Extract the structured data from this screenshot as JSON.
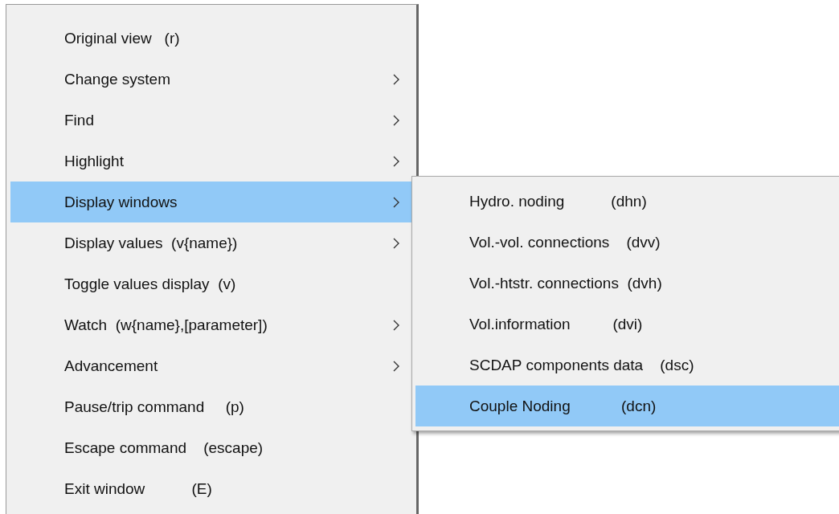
{
  "menu": {
    "items": [
      {
        "label": "Original view   (r)",
        "submenu": false,
        "selected": false
      },
      {
        "label": "Change system",
        "submenu": true,
        "selected": false
      },
      {
        "label": "Find",
        "submenu": true,
        "selected": false
      },
      {
        "label": "Highlight",
        "submenu": true,
        "selected": false
      },
      {
        "label": "Display windows",
        "submenu": true,
        "selected": true
      },
      {
        "label": "Display values  (v{name})",
        "submenu": true,
        "selected": false
      },
      {
        "label": "Toggle values display  (v)",
        "submenu": false,
        "selected": false
      },
      {
        "label": "Watch  (w{name},[parameter])",
        "submenu": true,
        "selected": false
      },
      {
        "label": "Advancement",
        "submenu": true,
        "selected": false
      },
      {
        "label": "Pause/trip command     (p)",
        "submenu": false,
        "selected": false
      },
      {
        "label": "Escape command    (escape)",
        "submenu": false,
        "selected": false
      },
      {
        "label": "Exit window           (E)",
        "submenu": false,
        "selected": false
      }
    ]
  },
  "submenu": {
    "items": [
      {
        "label": "Hydro. noding           (dhn)",
        "selected": false
      },
      {
        "label": "Vol.-vol. connections    (dvv)",
        "selected": false
      },
      {
        "label": "Vol.-htstr. connections  (dvh)",
        "selected": false
      },
      {
        "label": "Vol.information          (dvi)",
        "selected": false
      },
      {
        "label": "SCDAP components data    (dsc)",
        "selected": false
      },
      {
        "label": "Couple Noding            (dcn)",
        "selected": true
      }
    ]
  }
}
